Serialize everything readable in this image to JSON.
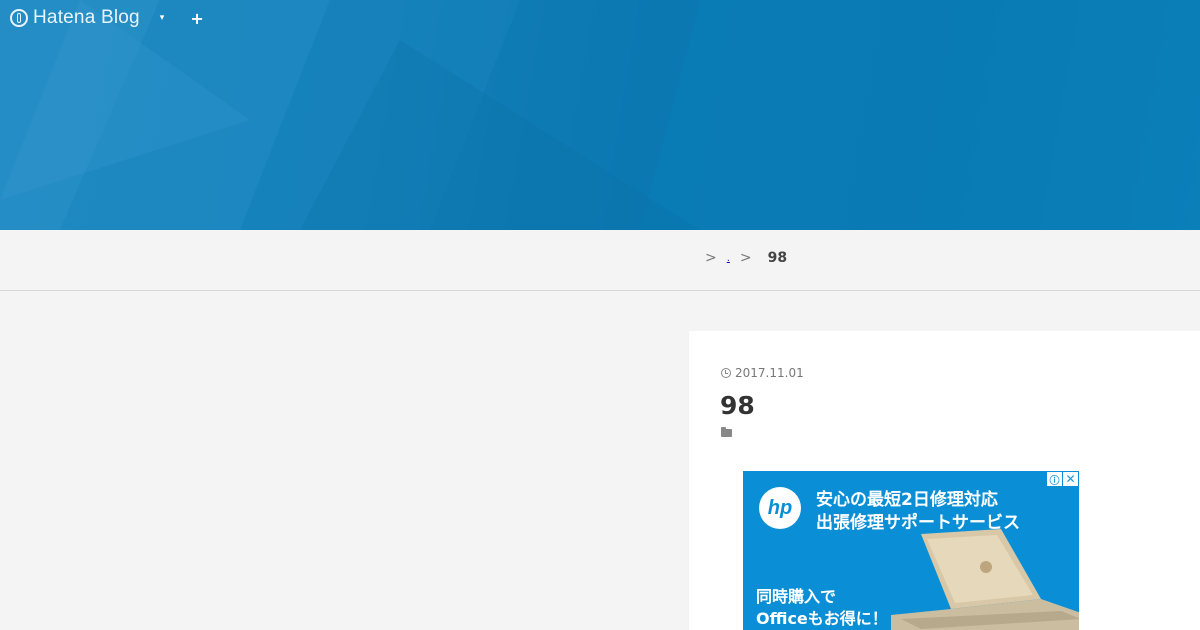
{
  "header": {
    "logo_text": "Hatena Blog",
    "menu_caret": "▾",
    "add_label": "+",
    "blog_title": "",
    "blog_description": ""
  },
  "breadcrumb": {
    "sep1": ">",
    "link1": ".",
    "sep2": ">",
    "current": "98"
  },
  "entry": {
    "date": "2017.11.01",
    "title": "98"
  },
  "ad": {
    "logo": "hp",
    "line1": "安心の最短2日修理対応",
    "line2": "出張修理サポートサービス",
    "line3": "同時購入で",
    "line4": "Officeもお得に！",
    "info_icon": "ⓘ",
    "close_icon": "✕"
  },
  "colors": {
    "header_blue": "#0b7ab3",
    "ad_blue": "#0a8fd6",
    "page_bg": "#f4f4f4"
  }
}
